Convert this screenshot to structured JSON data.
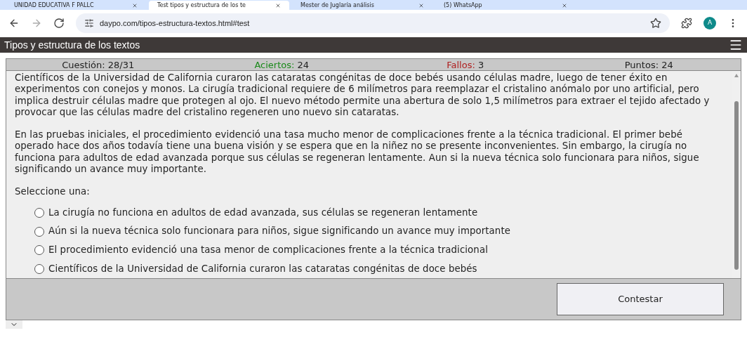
{
  "browser": {
    "tabs": [
      {
        "title": "UNIDAD EDUCATIVA F PALLC",
        "selected": false
      },
      {
        "title": "Test tipos y estructura de los te",
        "selected": true
      },
      {
        "title": "Mester de Juglaría análisis",
        "selected": false
      },
      {
        "title": "(5) WhatsApp",
        "selected": false
      }
    ],
    "url": "daypo.com/tipos-estructura-textos.html#test",
    "profile_initial": "A"
  },
  "header": {
    "title": "Tipos y estructura de los textos"
  },
  "stats": [
    {
      "label": "Cuestión:",
      "value": "28/31",
      "kind": "neutral"
    },
    {
      "label": "Aciertos:",
      "value": "24",
      "kind": "good"
    },
    {
      "label": "Fallos:",
      "value": "3",
      "kind": "bad"
    },
    {
      "label": "Puntos:",
      "value": "24",
      "kind": "neutral"
    }
  ],
  "question": {
    "paragraphs": [
      "Científicos de la Universidad de California curaron las cataratas congénitas de doce bebés usando células madre, luego de tener éxito en experimentos con conejos y monos. La cirugía tradicional requiere de 6 milímetros para reemplazar el cristalino anómalo por uno artificial, pero implica destruir células madre que protegen al ojo. El nuevo método permite una abertura de solo 1,5 milímetros para extraer el tejido afectado y provocar que las células madre del cristalino regeneren uno nuevo sin cataratas.",
      "En las pruebas iniciales, el procedimiento evidenció una tasa mucho menor de complicaciones frente a la técnica tradicional. El primer bebé operado hace dos años todavía tiene una buena visión y se espera que en la niñez no se presente inconvenientes. Sin embargo, la cirugía no funciona para adultos de edad avanzada porque sus células se regeneran lentamente. Aun si la nueva técnica solo funcionara para niños, sigue significando un avance muy importante."
    ],
    "prompt": "Seleccione una:",
    "options": [
      {
        "text": "La cirugía no funciona en adultos de edad avanzada, sus células se regeneran lentamente",
        "selected": false
      },
      {
        "text": "Aún si la nueva técnica solo funcionara para niños, sigue significando un avance muy importante",
        "selected": false
      },
      {
        "text": "El procedimiento evidenció una tasa menor de complicaciones frente a la técnica tradicional",
        "selected": false
      },
      {
        "text": "Científicos de la Universidad de California curaron las cataratas congénitas de doce bebés",
        "selected": false
      }
    ]
  },
  "submit_button": "Contestar"
}
